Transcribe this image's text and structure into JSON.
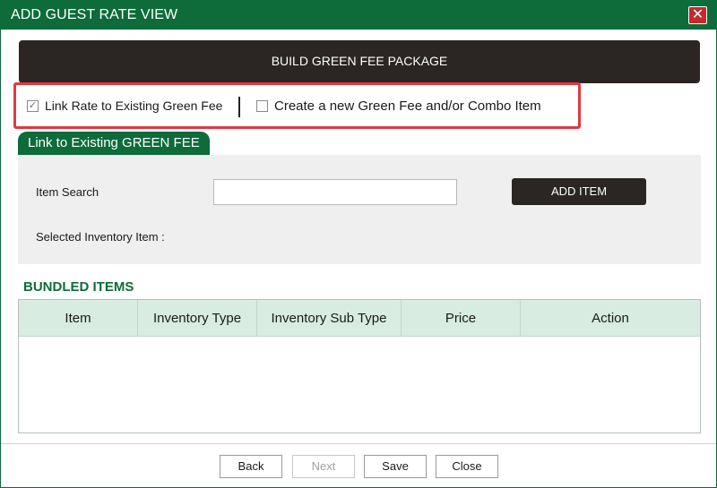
{
  "window": {
    "title": "ADD GUEST RATE VIEW",
    "close_glyph": "✕"
  },
  "build_bar": {
    "label": "BUILD GREEN FEE PACKAGE"
  },
  "options": {
    "link_rate": {
      "label": "Link Rate to Existing Green Fee",
      "checked": true
    },
    "create_new": {
      "label": "Create a new Green Fee and/or Combo Item",
      "checked": false
    }
  },
  "tab": {
    "label": "Link to Existing GREEN FEE"
  },
  "search": {
    "item_search_label": "Item Search",
    "item_search_value": "",
    "selected_inventory_label": "Selected Inventory Item :",
    "add_item_label": "ADD ITEM"
  },
  "bundled": {
    "title": "BUNDLED ITEMS",
    "columns": [
      "Item",
      "Inventory Type",
      "Inventory Sub Type",
      "Price",
      "Action"
    ],
    "rows": []
  },
  "footer": {
    "back": "Back",
    "next": "Next",
    "save": "Save",
    "close": "Close"
  },
  "colors": {
    "primary_green": "#0e6b3a",
    "dark": "#2b2624",
    "highlight_red": "#e0393e",
    "close_red": "#c8282c"
  }
}
